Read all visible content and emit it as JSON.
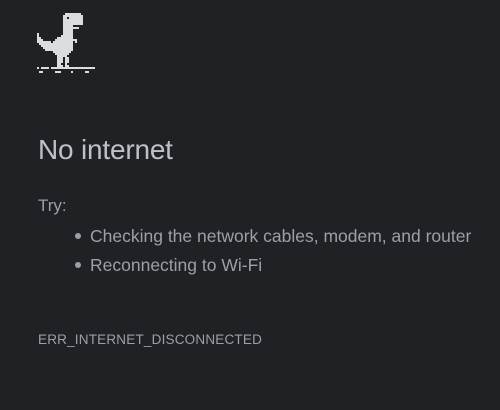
{
  "error_page": {
    "title": "No internet",
    "try_label": "Try:",
    "suggestions": [
      "Checking the network cables, modem, and router",
      "Reconnecting to Wi-Fi"
    ],
    "error_code": "ERR_INTERNET_DISCONNECTED"
  },
  "icon": "offline-dinosaur-icon",
  "colors": {
    "background": "#202124",
    "heading": "#bdc1c6",
    "text": "#9aa0a6",
    "dino": "#dadce0"
  }
}
